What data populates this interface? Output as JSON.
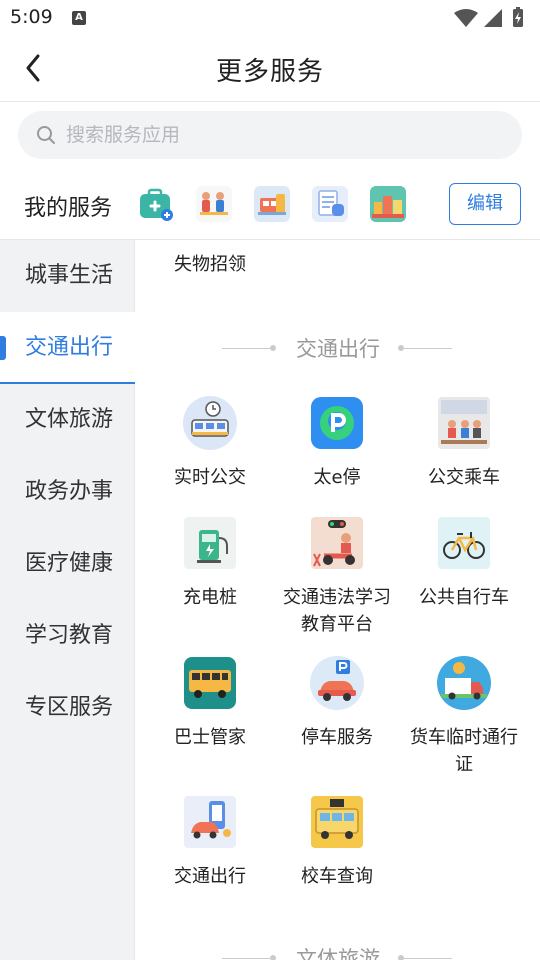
{
  "status_bar": {
    "time": "5:09",
    "badge": "A"
  },
  "header": {
    "title": "更多服务"
  },
  "search": {
    "placeholder": "搜索服务应用"
  },
  "my_services": {
    "title": "我的服务",
    "edit_label": "编辑",
    "icons": [
      "medical-kit-icon",
      "people-service-icon",
      "bus-ticket-icon",
      "checklist-icon",
      "city-view-icon"
    ]
  },
  "sidebar": {
    "items": [
      {
        "label": "城事生活"
      },
      {
        "label": "交通出行"
      },
      {
        "label": "文体旅游"
      },
      {
        "label": "政务办事"
      },
      {
        "label": "医疗健康"
      },
      {
        "label": "学习教育"
      },
      {
        "label": "专区服务"
      }
    ],
    "active_index": 1
  },
  "content": {
    "previous_item": "失物招领",
    "sections": [
      {
        "title": "交通出行",
        "tiles": [
          {
            "label": "实时公交",
            "icon": "realtime-bus-icon"
          },
          {
            "label": "太e停",
            "icon": "parking-app-icon"
          },
          {
            "label": "公交乘车",
            "icon": "bus-ride-icon"
          },
          {
            "label": "充电桩",
            "icon": "charging-pile-icon"
          },
          {
            "label": "交通违法学习教育平台",
            "icon": "traffic-education-icon"
          },
          {
            "label": "公共自行车",
            "icon": "bicycle-icon"
          },
          {
            "label": "巴士管家",
            "icon": "bus-manager-icon"
          },
          {
            "label": "停车服务",
            "icon": "parking-service-icon"
          },
          {
            "label": "货车临时通行证",
            "icon": "truck-pass-icon"
          },
          {
            "label": "交通出行",
            "icon": "traffic-travel-icon"
          },
          {
            "label": "校车查询",
            "icon": "school-bus-icon"
          }
        ]
      },
      {
        "title": "文体旅游"
      }
    ]
  },
  "colors": {
    "accent": "#2f7de1",
    "sidebar_bg": "#f0f2f4",
    "divider": "#c9cccf"
  }
}
